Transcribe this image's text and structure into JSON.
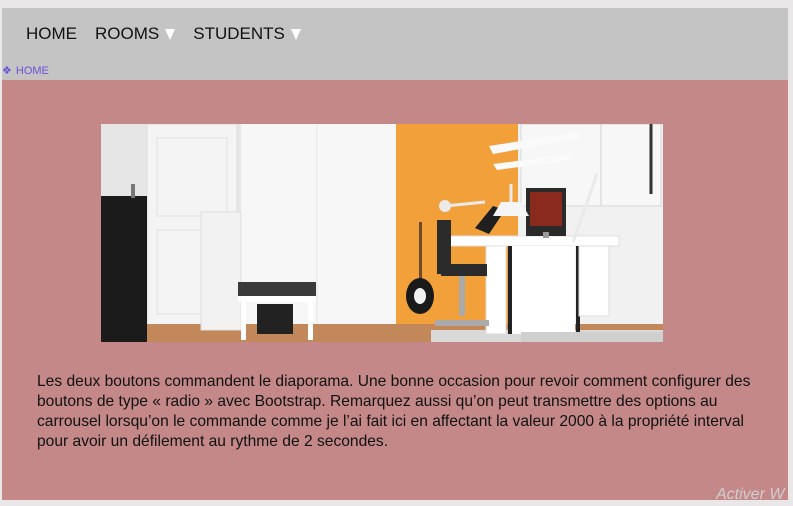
{
  "nav": {
    "items": [
      {
        "label": "HOME"
      },
      {
        "label": "ROOMS"
      },
      {
        "label": "STUDENTS"
      }
    ]
  },
  "breadcrumb": {
    "icon": "diamond-icon",
    "label": "HOME"
  },
  "slide": {
    "image": "bedroom-desk-photo"
  },
  "description": "Les deux boutons commandent le diaporama. Une bonne occasion pour revoir comment configurer des boutons de type « radio » avec Bootstrap. Remarquez aussi qu’on peut transmettre des options au carrousel lorsqu’on le commande comme je l’ai fait ici en affectant la valeur 2000 à la propriété interval pour avoir un défilement au rythme de 2 secondes.",
  "watermark": "Activer W",
  "colors": {
    "navbar": "#c4c4c4",
    "content": "#c48889",
    "breadcrumb": "#6b53d6",
    "accent_wall": "#f2a03a"
  }
}
